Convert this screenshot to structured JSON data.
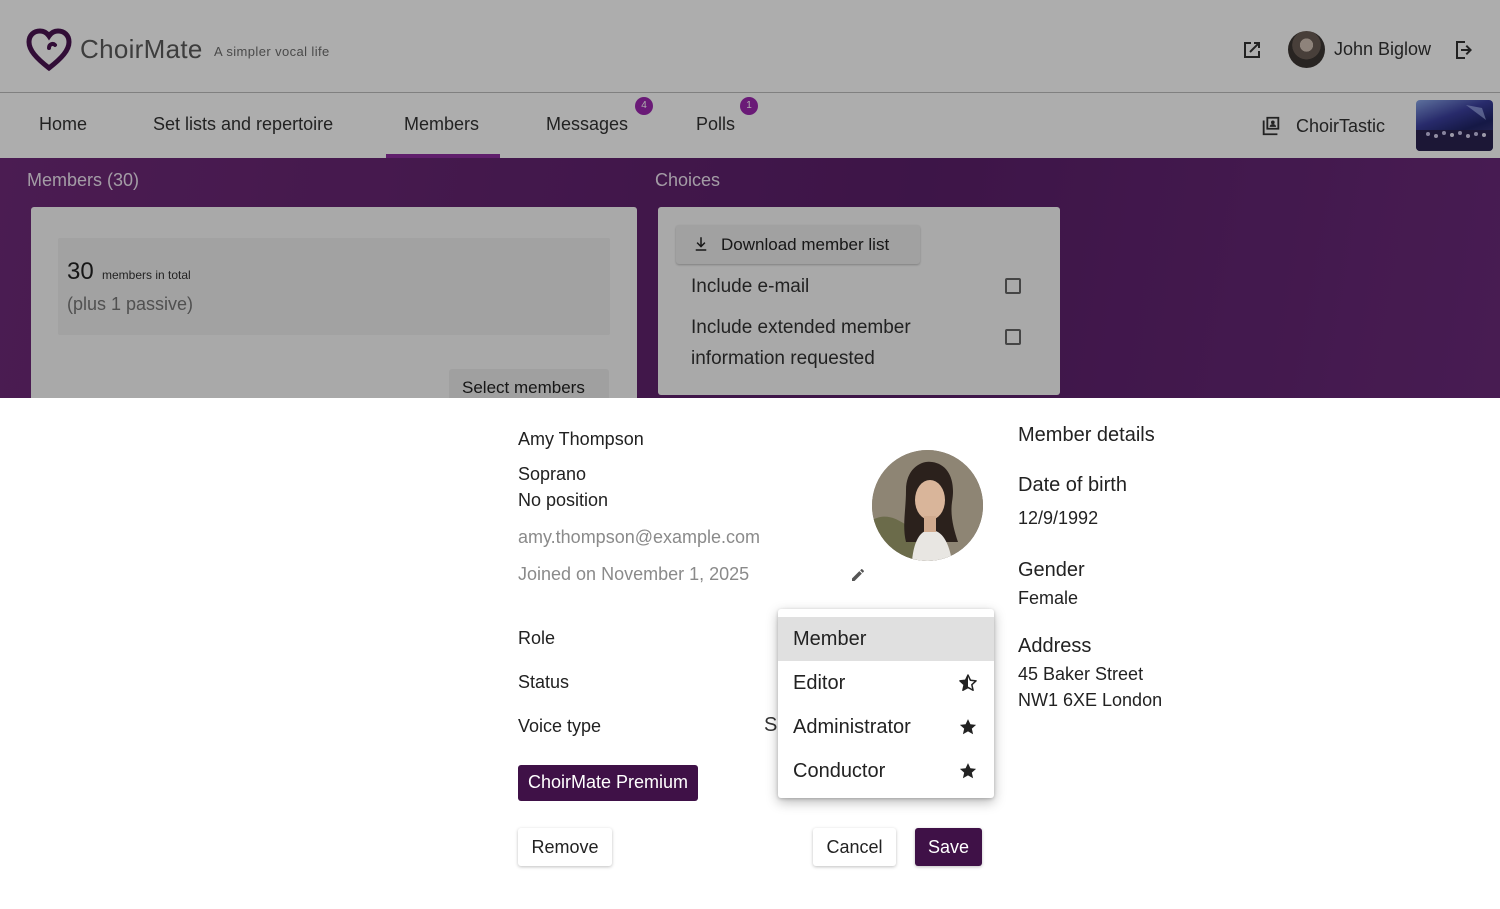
{
  "header": {
    "brand": "ChoirMate",
    "tagline": "A simpler vocal life",
    "user_name": "John Biglow"
  },
  "nav": {
    "items": [
      {
        "label": "Home"
      },
      {
        "label": "Set lists and repertoire"
      },
      {
        "label": "Members",
        "active": true
      },
      {
        "label": "Messages",
        "badge": "4"
      },
      {
        "label": "Polls",
        "badge": "1"
      }
    ],
    "choir_name": "ChoirTastic"
  },
  "members_section": {
    "title": "Members (30)",
    "count": "30",
    "count_label": "members in total",
    "passive_note": "(plus 1 passive)",
    "select_button": "Select members"
  },
  "choices_section": {
    "title": "Choices",
    "download_button": "Download member list",
    "options": [
      {
        "label": "Include e-mail",
        "checked": false
      },
      {
        "label": "Include extended member information requested",
        "checked": false
      }
    ]
  },
  "dialog": {
    "member_name": "Amy Thompson",
    "voice": "Soprano",
    "position": "No position",
    "email": "amy.thompson@example.com",
    "joined": "Joined on November 1, 2025",
    "role_label": "Role",
    "status_label": "Status",
    "voice_type_label": "Voice type",
    "voice_type_value_fragment": "S",
    "premium_badge": "ChoirMate Premium",
    "remove_button": "Remove",
    "cancel_button": "Cancel",
    "save_button": "Save"
  },
  "member_details": {
    "title": "Member details",
    "dob_label": "Date of birth",
    "dob_value": "12/9/1992",
    "gender_label": "Gender",
    "gender_value": "Female",
    "address_label": "Address",
    "address_line1": "45 Baker Street",
    "address_line2": "NW1 6XE London"
  },
  "role_menu": {
    "options": [
      {
        "label": "Member",
        "selected": true,
        "icon": "none"
      },
      {
        "label": "Editor",
        "icon": "star-half-icon"
      },
      {
        "label": "Administrator",
        "icon": "star-icon"
      },
      {
        "label": "Conductor",
        "icon": "star-icon"
      }
    ]
  },
  "colors": {
    "accent": "#3f1147",
    "nav_underline": "#8e2fa0",
    "badge": "#9c27b0",
    "content_bg": "#5b1f6a"
  }
}
